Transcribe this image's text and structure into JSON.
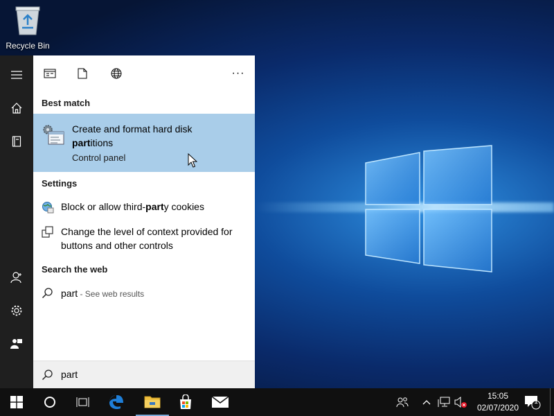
{
  "desktop": {
    "icons": [
      {
        "label": "Recycle Bin",
        "icon": "recycle-bin-icon"
      }
    ]
  },
  "start_rail": {
    "items": [
      {
        "name": "menu-icon"
      },
      {
        "name": "home-icon"
      },
      {
        "name": "notebook-icon"
      },
      {
        "name": "account-icon"
      },
      {
        "name": "settings-icon"
      },
      {
        "name": "feedback-icon"
      }
    ]
  },
  "search_panel": {
    "filters": [
      "apps-filter",
      "documents-filter",
      "web-filter"
    ],
    "more_label": "···",
    "best_match": {
      "heading": "Best match",
      "title_prefix": "Create and format hard disk",
      "title_bold": "part",
      "title_suffix": "itions",
      "subtitle": "Control panel"
    },
    "settings": {
      "heading": "Settings",
      "items": [
        {
          "prefix": "Block or allow third-",
          "bold": "part",
          "suffix": "y cookies"
        },
        {
          "prefix": "Change the level of context provided for buttons and other controls",
          "bold": "",
          "suffix": ""
        }
      ]
    },
    "web": {
      "heading": "Search the web",
      "query": "part",
      "hint": " - See web results"
    },
    "search_box": {
      "value": "part"
    }
  },
  "taskbar": {
    "time": "15:05",
    "date": "02/07/2020",
    "notification_count": "1",
    "colors": {
      "edge": "#1f7fd8",
      "folder": "#f0c040",
      "taskbar": "#101010"
    }
  }
}
